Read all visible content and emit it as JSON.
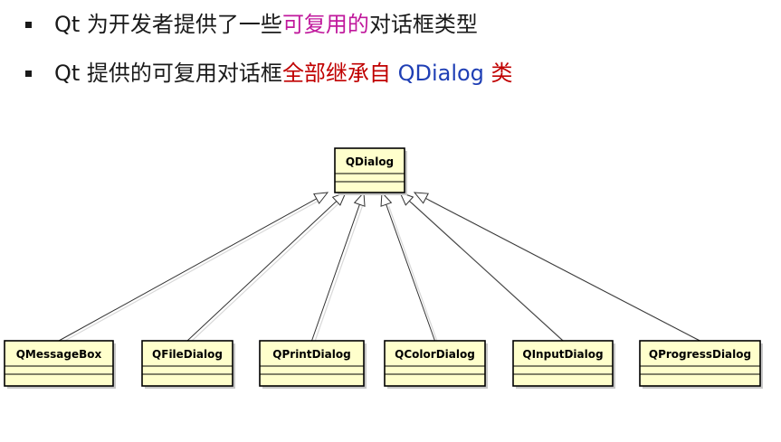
{
  "bullets": [
    {
      "segments": [
        {
          "text": "Qt 为开发者提供了一些",
          "color": "#1a1a1a"
        },
        {
          "text": "可复用的",
          "color": "#c0189c"
        },
        {
          "text": "对话框类型",
          "color": "#1a1a1a"
        }
      ]
    },
    {
      "segments": [
        {
          "text": "Qt 提供的可复用对话框",
          "color": "#1a1a1a"
        },
        {
          "text": "全部继承自",
          "color": "#c00000"
        },
        {
          "text": " QDialog ",
          "color": "#1f3fb5"
        },
        {
          "text": "类",
          "color": "#c00000"
        }
      ]
    }
  ],
  "diagram": {
    "parent": "QDialog",
    "children": [
      "QMessageBox",
      "QFileDialog",
      "QPrintDialog",
      "QColorDialog",
      "QInputDialog",
      "QProgressDialog"
    ],
    "colors": {
      "box_fill": "#ffffcc",
      "box_stroke": "#000000",
      "shadow": "#c8c8c8"
    }
  }
}
